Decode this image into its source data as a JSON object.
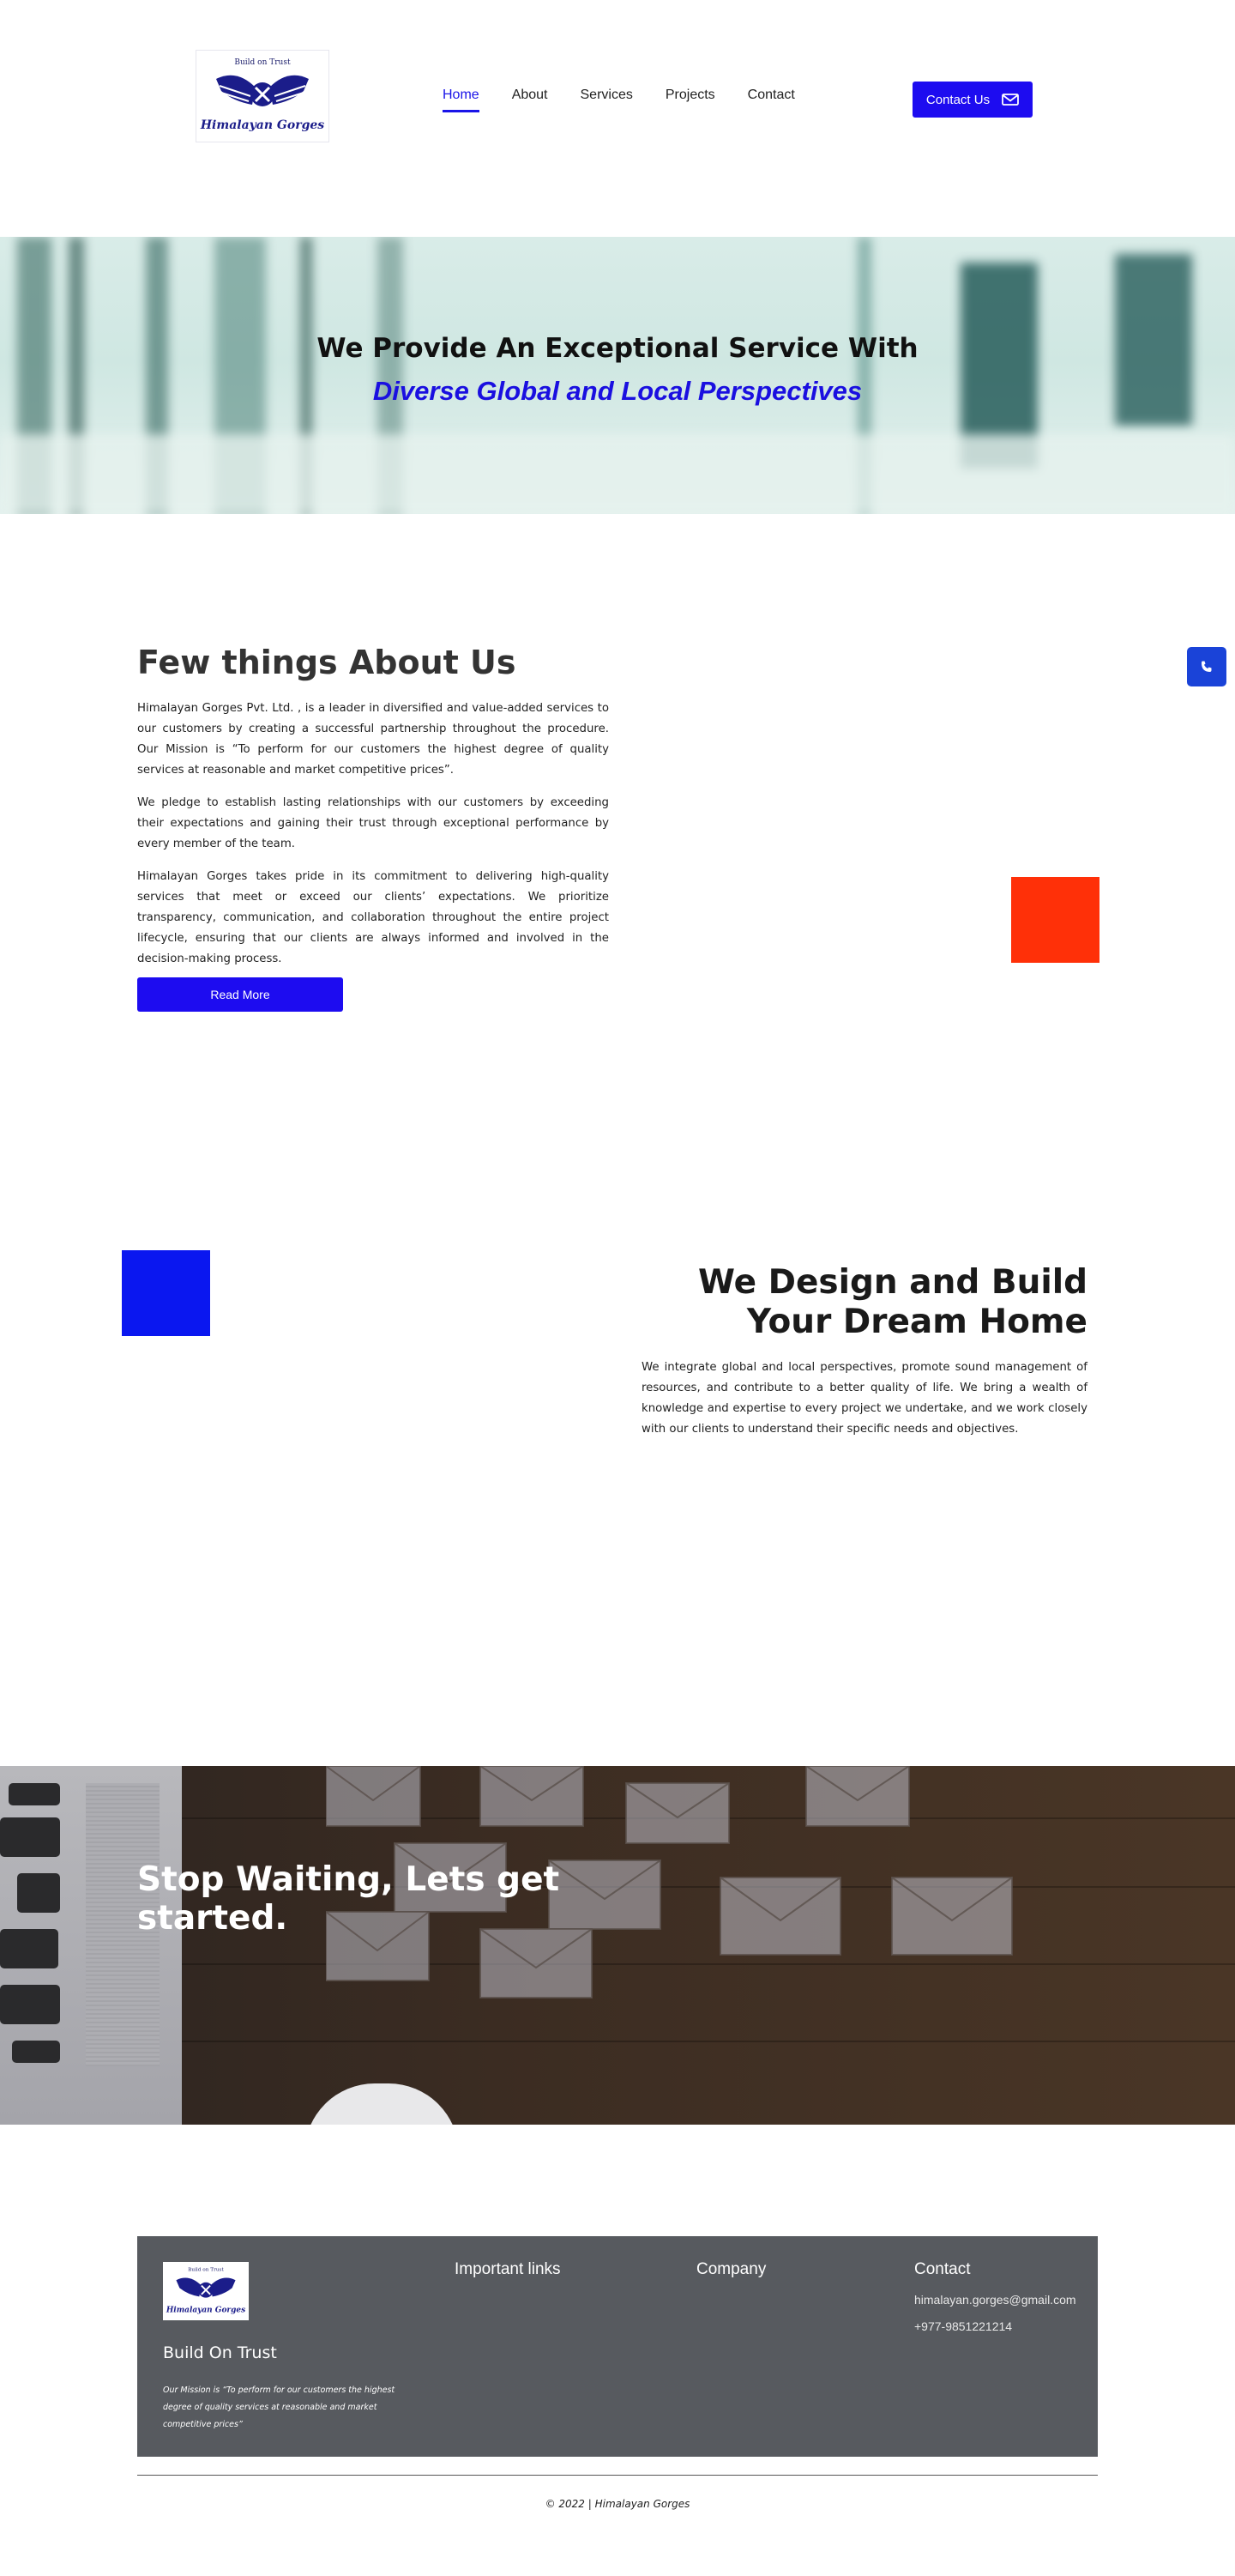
{
  "header": {
    "logo": {
      "top_text": "Build on Trust",
      "name": "Himalayan Gorges"
    },
    "nav": [
      {
        "label": "Home",
        "active": true
      },
      {
        "label": "About",
        "active": false
      },
      {
        "label": "Services",
        "active": false
      },
      {
        "label": "Projects",
        "active": false
      },
      {
        "label": "Contact",
        "active": false
      }
    ],
    "contact_button": "Contact Us"
  },
  "hero": {
    "line1": "We Provide An Exceptional Service With",
    "line2": "Diverse Global and Local Perspectives"
  },
  "about": {
    "title": "Few things About Us",
    "paragraphs": [
      "Himalayan Gorges Pvt. Ltd. , is a leader in diversified and value-added services to our customers by creating a successful partnership throughout the procedure. Our Mission is “To perform for our customers the highest degree of quality services at reasonable and market competitive prices”.",
      "We pledge to establish lasting relationships with our customers by exceeding their expectations and gaining their trust through exceptional performance by every member of the team.",
      "Himalayan Gorges takes pride in its commitment to delivering high-quality services that meet or exceed our clients’ expectations. We prioritize transparency, communication, and collaboration throughout the entire project lifecycle, ensuring that our clients are always informed and involved in the decision-making process."
    ],
    "read_more": "Read More"
  },
  "design": {
    "title_line1": "We Design and Build",
    "title_line2": "Your Dream Home",
    "text": "We integrate global and local perspectives, promote sound management of resources, and contribute to a better quality of life. We bring a wealth of knowledge and expertise to every project we undertake, and we work closely with our clients to understand their specific needs and objectives."
  },
  "cta": {
    "title_line1": "Stop Waiting, Lets get",
    "title_line2": "started."
  },
  "footer": {
    "tagline": "Build On Trust",
    "mission": "Our Mission is “To perform for our customers the highest degree of quality services at reasonable and market competitive prices”",
    "important_links_heading": "Important links",
    "company_heading": "Company",
    "contact_heading": "Contact",
    "email": "himalayan.gorges@gmail.com",
    "phone": "+977-9851221214",
    "copyright": "© 2022 | Himalayan Gorges"
  },
  "colors": {
    "accent_blue": "#1d0cf0",
    "orange_square": "#ff3008",
    "blue_square": "#0a17f0",
    "footer_panel": "#575a5f"
  }
}
